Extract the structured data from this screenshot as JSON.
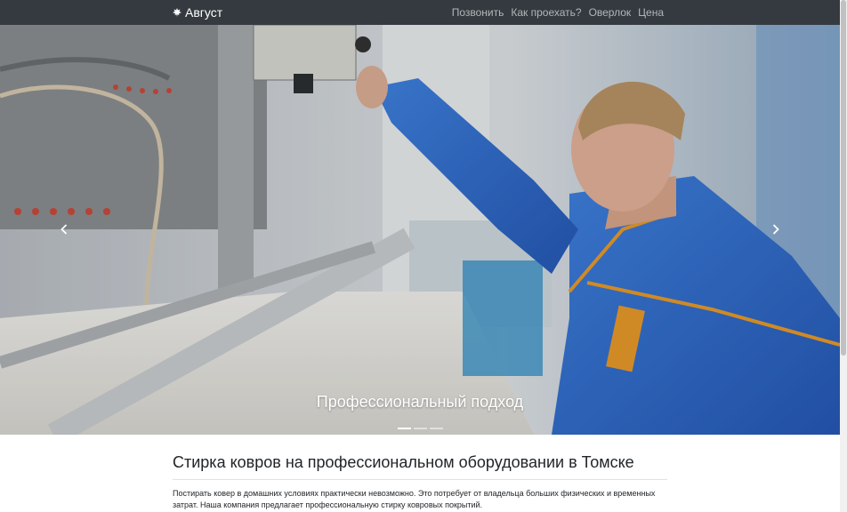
{
  "navbar": {
    "brand": "Август",
    "brand_icon": "leaf-icon",
    "links": [
      "Позвонить",
      "Как проехать?",
      "Оверлок",
      "Цена"
    ]
  },
  "carousel": {
    "caption": "Профессиональный подход",
    "slide_count": 3,
    "active_index": 0,
    "image_description": "worker in blue uniform at carpet washing machine"
  },
  "main": {
    "heading": "Стирка ковров на профессиональном оборудовании в Томске",
    "paragraph": "Постирать ковер в домашних условиях практически невозможно. Это потребует от владельца больших физических и временных затрат. Наша компания предлагает профессиональную стирку ковровых покрытий."
  },
  "colors": {
    "navbar_bg": "#343a40",
    "uniform_blue": "#2f6fd1",
    "accent_orange": "#e89a2a"
  }
}
